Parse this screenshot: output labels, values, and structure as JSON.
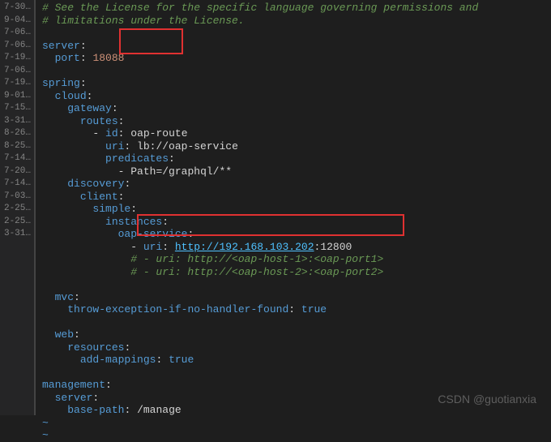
{
  "gutter": [
    "7-30…",
    "9-04…",
    "7-06…",
    "7-06…",
    "",
    "7-19…",
    "7-06…",
    "",
    "7-19…",
    "",
    "9-01…",
    "7-15…",
    "3-31…",
    "",
    "8-26…",
    "8-25…",
    "",
    "7-14…",
    "7-20…",
    "7-14…",
    "7-03…",
    "2-25…",
    "",
    "2-25…",
    "",
    "3-31…",
    "",
    "",
    "",
    "",
    "",
    "",
    ""
  ],
  "comment1": "# See the License for the specific language governing permissions and",
  "comment2": "# limitations under the License.",
  "server": {
    "key": "server",
    "port_key": "port",
    "port_value": "18088"
  },
  "spring": {
    "key": "spring",
    "cloud": {
      "key": "cloud",
      "gateway": {
        "key": "gateway",
        "routes": {
          "key": "routes",
          "id_key": "id",
          "id_value": "oap-route",
          "uri_key": "uri",
          "uri_value": "lb://oap-service",
          "predicates_key": "predicates",
          "path": "Path=/graphql/**"
        }
      },
      "discovery": {
        "key": "discovery",
        "client": {
          "key": "client",
          "simple": {
            "key": "simple",
            "instances": {
              "key": "instances",
              "service_key": "oap-service",
              "uri_key": "uri",
              "uri_link": "http://192.168.103.202",
              "uri_port": ":12800",
              "c1": "# - uri: http://<oap-host-1>:<oap-port1>",
              "c2": "# - uri: http://<oap-host-2>:<oap-port2>"
            }
          }
        }
      }
    },
    "mvc": {
      "key": "mvc",
      "throw_key": "throw-exception-if-no-handler-found",
      "throw_val": "true"
    },
    "web": {
      "key": "web",
      "resources_key": "resources",
      "add_key": "add-mappings",
      "add_val": "true"
    }
  },
  "management": {
    "key": "management",
    "server_key": "server",
    "base_key": "base-path",
    "base_val": "/manage"
  },
  "tilde": "~",
  "watermark": "CSDN @guotianxia"
}
